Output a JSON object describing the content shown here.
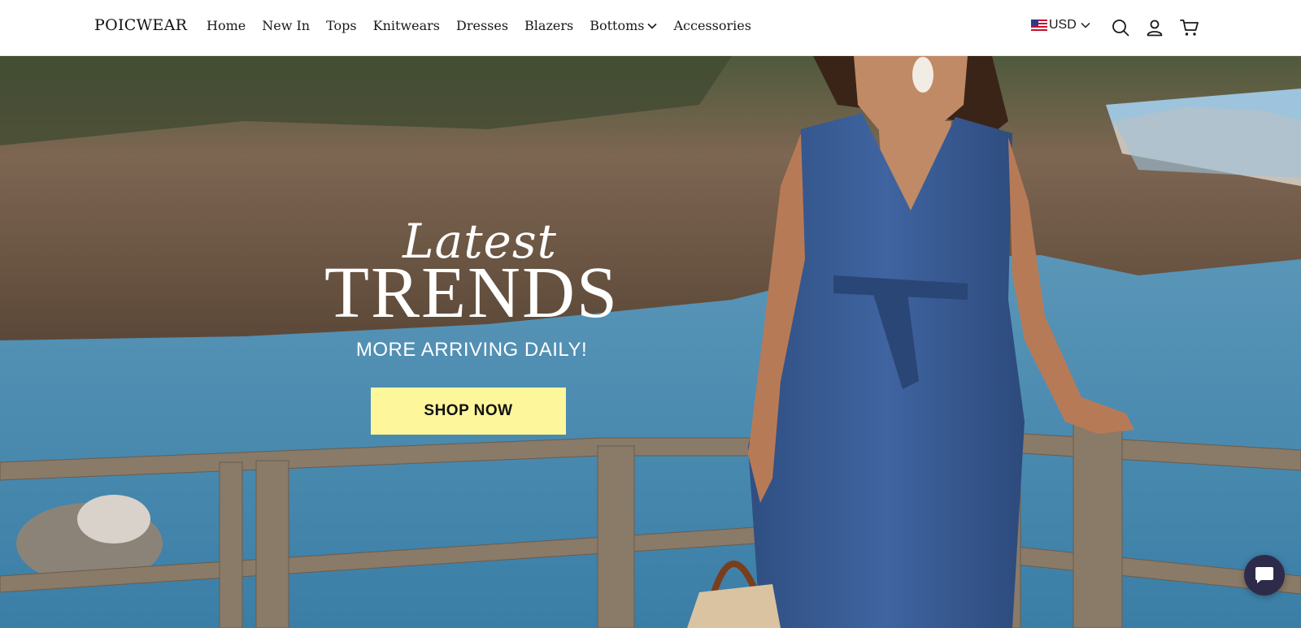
{
  "header": {
    "logo": "POICWEAR",
    "nav": [
      {
        "label": "Home"
      },
      {
        "label": "New In"
      },
      {
        "label": "Tops"
      },
      {
        "label": "Knitwears"
      },
      {
        "label": "Dresses"
      },
      {
        "label": "Blazers"
      },
      {
        "label": "Bottoms",
        "has_dropdown": true
      },
      {
        "label": "Accessories"
      }
    ],
    "currency": "USD",
    "icons": [
      "us-flag-icon",
      "chevron-down-icon",
      "search-icon",
      "account-icon",
      "cart-icon"
    ]
  },
  "hero": {
    "script_text": "Latest",
    "title": "TRENDS",
    "subtitle": "MORE ARRIVING DAILY!",
    "cta_label": "SHOP NOW",
    "cta_color": "#fdf69b"
  },
  "chat": {
    "icon": "chat-icon",
    "color": "#2e2b4a"
  }
}
